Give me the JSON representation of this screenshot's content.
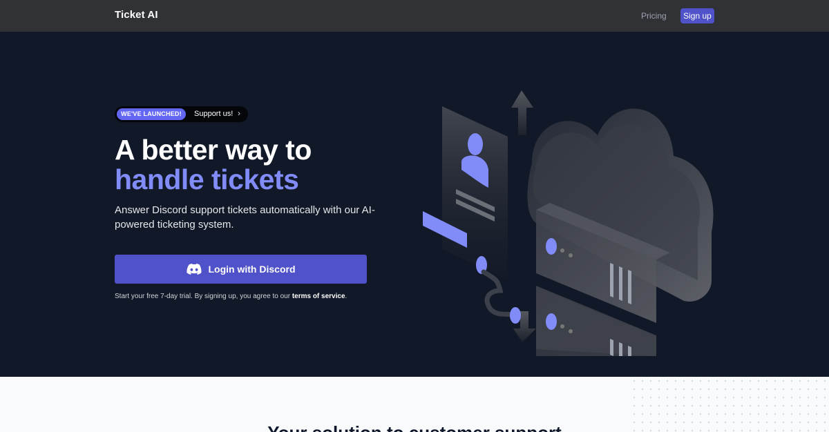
{
  "nav": {
    "brand": "Ticket AI",
    "pricing": "Pricing",
    "signup": "Sign up"
  },
  "hero": {
    "badge_pill": "WE'VE LAUNCHED!",
    "badge_text": "Support us!",
    "title_line1": "A better way to",
    "title_line2": "handle tickets",
    "subtitle": "Answer Discord support tickets automatically with our AI-powered ticketing system.",
    "cta_label": "Login with Discord",
    "fine_prefix": "Start your free 7-day trial. By signing up, you agree to our ",
    "fine_link": "terms of service",
    "fine_suffix": "."
  },
  "section": {
    "title": "Your solution to customer support"
  },
  "colors": {
    "accent": "#4f52c8",
    "accent_light": "#818cf8",
    "hero_bg": "#111827",
    "nav_bg": "#303236"
  }
}
